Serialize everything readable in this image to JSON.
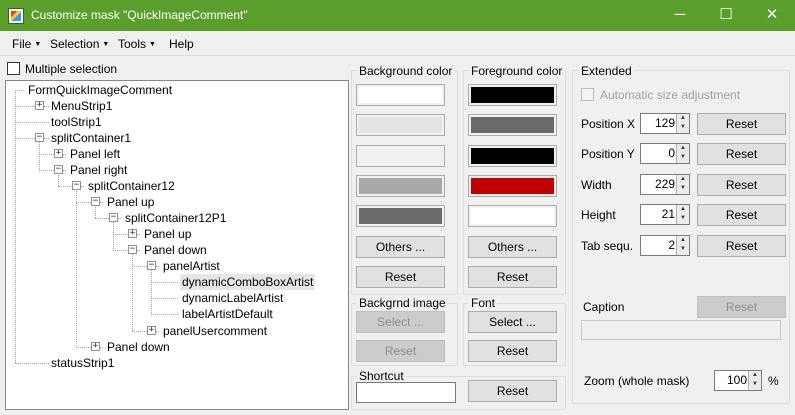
{
  "window": {
    "title": "Customize mask \"QuickImageComment\"",
    "minimize_glyph": "─",
    "maximize_glyph": "☐",
    "close_glyph": "✕",
    "titlebar_color": "#5a9e2c"
  },
  "menu": {
    "file": "File",
    "selection": "Selection",
    "tools": "Tools",
    "help": "Help",
    "dropdown_glyph": "▼"
  },
  "multiple_selection": {
    "label": "Multiple selection",
    "checked": false
  },
  "tree": {
    "expanded_glyph": "−",
    "collapsed_glyph": "+",
    "nodes": [
      "FormQuickImageComment",
      "MenuStrip1",
      "toolStrip1",
      "splitContainer1",
      "Panel left",
      "Panel right",
      "splitContainer12",
      "Panel up",
      "splitContainer12P1",
      "Panel up",
      "Panel down",
      "panelArtist",
      "dynamicComboBoxArtist",
      "dynamicLabelArtist",
      "labelArtistDefault",
      "panelUsercomment",
      "Panel down",
      "statusStrip1"
    ],
    "selected": "dynamicComboBoxArtist"
  },
  "background_color": {
    "title": "Background color",
    "swatches": [
      "#ffffff",
      "#e3e3e3",
      "#f0f0f0",
      "#a9a9a9",
      "#696969"
    ],
    "others_label": "Others ...",
    "reset_label": "Reset"
  },
  "foreground_color": {
    "title": "Foreground color",
    "swatches": [
      "#000000",
      "#696969",
      "#000000",
      "#c00000",
      "#ffffff"
    ],
    "others_label": "Others ...",
    "reset_label": "Reset"
  },
  "background_image": {
    "title": "Backgrnd image",
    "select_label": "Select ...",
    "reset_label": "Reset"
  },
  "font": {
    "title": "Font",
    "select_label": "Select ...",
    "reset_label": "Reset"
  },
  "shortcut": {
    "title": "Shortcut",
    "value": "",
    "reset_label": "Reset"
  },
  "extended": {
    "title": "Extended",
    "auto_size_label": "Automatic size adjustment",
    "auto_size_checked": false,
    "fields": [
      {
        "label": "Position X",
        "value": "129",
        "reset": "Reset"
      },
      {
        "label": "Position Y",
        "value": "0",
        "reset": "Reset"
      },
      {
        "label": "Width",
        "value": "229",
        "reset": "Reset"
      },
      {
        "label": "Height",
        "value": "21",
        "reset": "Reset"
      },
      {
        "label": "Tab sequ.",
        "value": "2",
        "reset": "Reset"
      }
    ],
    "caption_label": "Caption",
    "caption_reset": "Reset",
    "caption_value": "",
    "zoom_label": "Zoom (whole mask)",
    "zoom_value": "100",
    "zoom_unit": "%"
  },
  "spin_up_glyph": "▲",
  "spin_down_glyph": "▼"
}
